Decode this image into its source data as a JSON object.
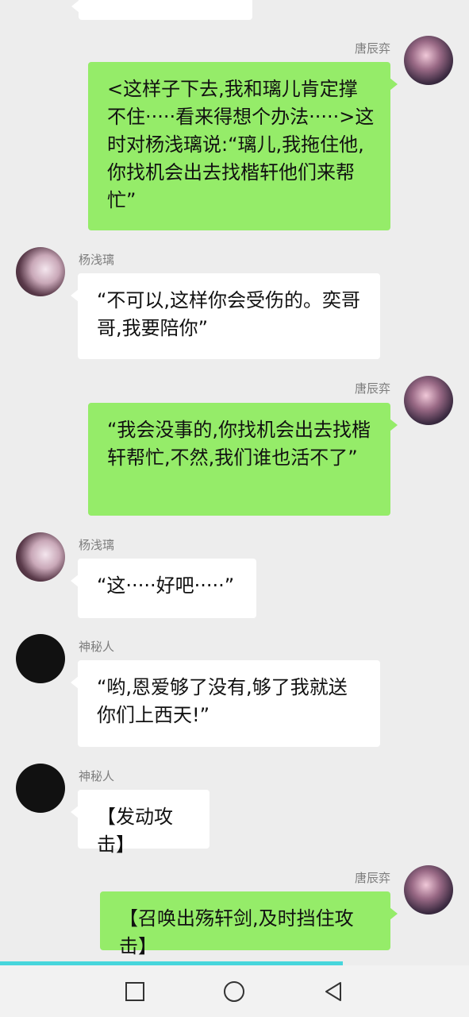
{
  "chat": {
    "messages": [
      {
        "sender": "partial",
        "text": ""
      },
      {
        "sender": "唐辰弈",
        "text": "<这样子下去,我和璃儿肯定撑不住·····看来得想个办法·····>这时对杨浅璃说:“璃儿,我拖住他,你找机会出去找楷轩他们来帮忙”"
      },
      {
        "sender": "杨浅璃",
        "text": "“不可以,这样你会受伤的。奕哥哥,我要陪你”"
      },
      {
        "sender": "唐辰弈",
        "text": "“我会没事的,你找机会出去找楷轩帮忙,不然,我们谁也活不了”"
      },
      {
        "sender": "杨浅璃",
        "text": "“这·····好吧·····”"
      },
      {
        "sender": "神秘人",
        "text": "“哟,恩爱够了没有,够了我就送你们上西天!”"
      },
      {
        "sender": "神秘人",
        "text": "【发动攻击】"
      },
      {
        "sender": "唐辰弈",
        "text": "【召唤出殇轩剑,及时挡住攻击】"
      }
    ]
  },
  "colors": {
    "background": "#ededed",
    "self_bubble": "#95ec69",
    "other_bubble": "#ffffff",
    "progress": "#47d6dc"
  },
  "navbar": {
    "icons": [
      "square-icon",
      "circle-icon",
      "back-triangle-icon"
    ]
  }
}
